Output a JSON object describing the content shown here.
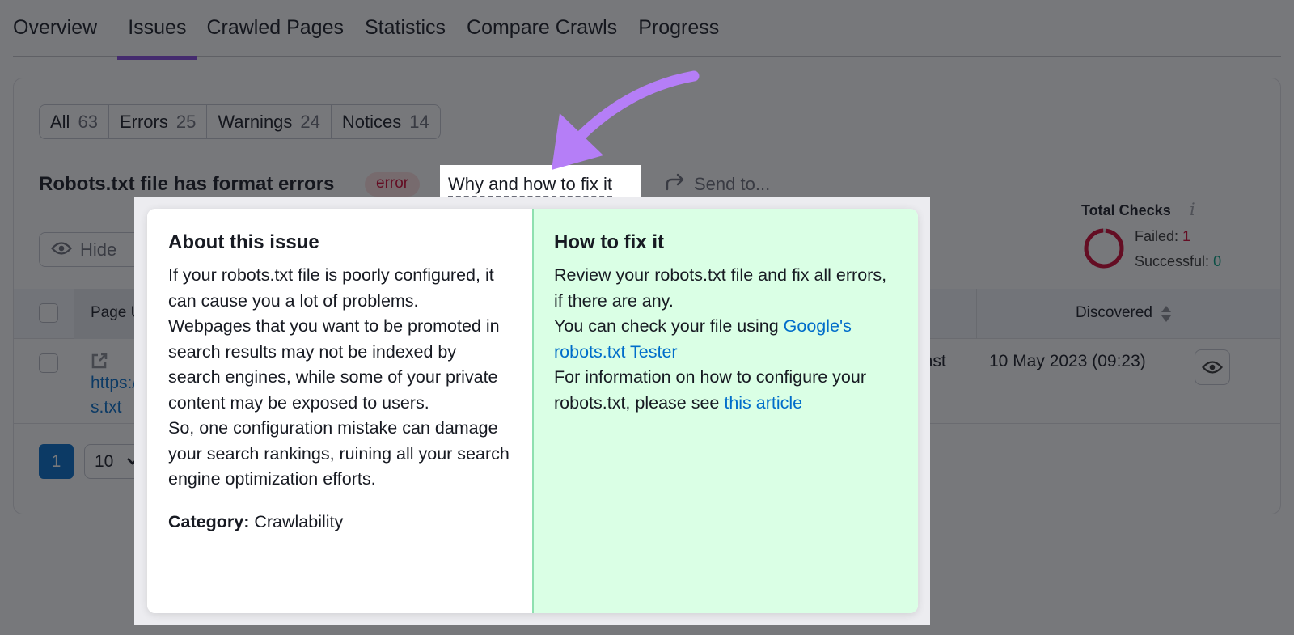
{
  "tabs": [
    {
      "label": "Overview",
      "active": false
    },
    {
      "label": "Issues",
      "active": true
    },
    {
      "label": "Crawled Pages",
      "active": false
    },
    {
      "label": "Statistics",
      "active": false
    },
    {
      "label": "Compare Crawls",
      "active": false
    },
    {
      "label": "Progress",
      "active": false
    }
  ],
  "filters": [
    {
      "label": "All",
      "count": "63"
    },
    {
      "label": "Errors",
      "count": "25"
    },
    {
      "label": "Warnings",
      "count": "24"
    },
    {
      "label": "Notices",
      "count": "14"
    }
  ],
  "issue": {
    "title": "Robots.txt file has format errors",
    "badge": "error",
    "why_link": "Why and how to fix it",
    "send_to": "Send to..."
  },
  "hide_button": "Hide",
  "total_checks": {
    "title": "Total Checks",
    "info_icon": "i",
    "failed_label": "Failed:",
    "failed_value": "1",
    "successful_label": "Successful:",
    "successful_value": "0",
    "failed_fraction": 1.0
  },
  "table": {
    "columns": [
      "Page URL",
      "Discovered"
    ],
    "rows": [
      {
        "url_line1": "https:/",
        "url_line2": "s.txt",
        "extra": "ext-inst",
        "discovered": "10 May 2023 (09:23)"
      }
    ]
  },
  "pagination": {
    "current_page": "1",
    "page_size": "10"
  },
  "popup": {
    "about": {
      "heading": "About this issue",
      "paragraphs": [
        "If your robots.txt file is poorly configured, it can cause you a lot of problems.",
        "Webpages that you want to be promoted in search results may not be indexed by search engines, while some of your private content may be exposed to users.",
        "So, one configuration mistake can damage your search rankings, ruining all your search engine optimization efforts."
      ],
      "category_label": "Category:",
      "category_value": "Crawlability"
    },
    "fix": {
      "heading": "How to fix it",
      "p1": "Review your robots.txt file and fix all errors, if there are any.",
      "p2_text": "You can check your file using ",
      "p2_link": "Google's robots.txt Tester",
      "p3_text": "For information on how to configure your robots.txt, please see ",
      "p3_link": "this article"
    }
  },
  "colors": {
    "accent": "#8649e1",
    "annotation_arrow": "#b57ef7",
    "error": "#d1002f",
    "success": "#009f81",
    "link": "#006dca",
    "fix_panel_bg": "#daffe5"
  }
}
